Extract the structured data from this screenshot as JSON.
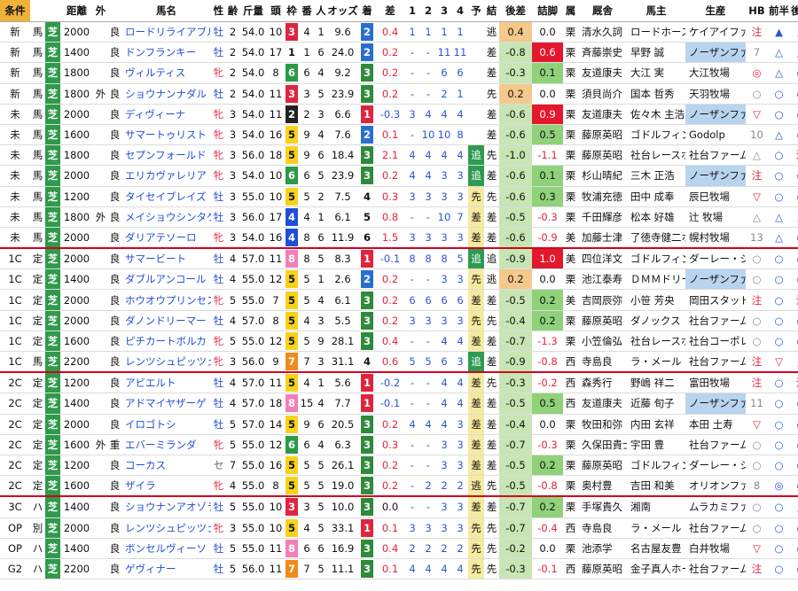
{
  "headers": [
    "条件",
    "",
    "",
    "距離",
    "外",
    "",
    "馬名",
    "性",
    "齢",
    "斤量",
    "頭",
    "枠",
    "番",
    "人",
    "オッズ",
    "着",
    "差",
    "1",
    "2",
    "3",
    "4",
    "予",
    "結",
    "後差",
    "詰脚",
    "属",
    "厩舎",
    "馬主",
    "生産",
    "HB",
    "前半",
    "後半"
  ],
  "waku_colors": {
    "1": "#ffffff",
    "2": "#222222",
    "3": "#e0243e",
    "4": "#1e4fd8",
    "5": "#f7d21a",
    "6": "#2a9a46",
    "7": "#f08a1a",
    "8": "#f27fb8"
  },
  "rank_colors": {
    "1": "#e0243e",
    "2": "#2a6fd0",
    "3": "#2f8a3a"
  },
  "rows": [
    {
      "c": "新",
      "k": "馬",
      "s": "芝",
      "d": "2000",
      "o": "",
      "g": "良",
      "name": "ロードリライアブル",
      "sex": "牡",
      "age": "2",
      "w": "54.0",
      "h": "10",
      "waku": "3",
      "no": "4",
      "pop": "1",
      "odds": "9.6",
      "r": "2",
      "diff": "0.4",
      "p1": "1",
      "p2": "1",
      "p3": "1",
      "p4": "1",
      "yo": "",
      "ke": "逃",
      "b": "0.4",
      "t": "0.0",
      "z": "栗",
      "st": "清水久詞",
      "ow": "ロードホース",
      "pr": "ケイアイファ",
      "hb": "注",
      "f": "▲",
      "l": "▲"
    },
    {
      "c": "新",
      "k": "馬",
      "s": "芝",
      "d": "1400",
      "o": "",
      "g": "良",
      "name": "ドンフランキー",
      "sex": "牡",
      "age": "2",
      "w": "54.0",
      "h": "17",
      "waku": "1",
      "no": "1",
      "pop": "6",
      "odds": "24.0",
      "r": "2",
      "diff": "0.2",
      "p1": "-",
      "p2": "-",
      "p3": "11",
      "p4": "11",
      "yo": "",
      "ke": "差",
      "b": "-0.8",
      "t": "0.6",
      "z": "栗",
      "st": "斉藤崇史",
      "ow": "早野 誠",
      "pr": "ノーザンファ",
      "hb": "7",
      "f": "△",
      "l": "△"
    },
    {
      "c": "新",
      "k": "馬",
      "s": "芝",
      "d": "1800",
      "o": "",
      "g": "良",
      "name": "ヴィルティス",
      "sex": "牝",
      "age": "2",
      "w": "54.0",
      "h": "8",
      "waku": "6",
      "no": "6",
      "pop": "4",
      "odds": "9.2",
      "r": "3",
      "diff": "0.2",
      "p1": "-",
      "p2": "-",
      "p3": "6",
      "p4": "6",
      "yo": "",
      "ke": "差",
      "b": "-0.3",
      "t": "0.1",
      "z": "栗",
      "st": "友道康夫",
      "ow": "大江 実",
      "pr": "大江牧場",
      "hb": "◎",
      "f": "△",
      "l": "○"
    },
    {
      "c": "新",
      "k": "馬",
      "s": "芝",
      "d": "1800",
      "o": "外",
      "g": "良",
      "name": "ショウナンナダル",
      "sex": "牡",
      "age": "2",
      "w": "54.0",
      "h": "11",
      "waku": "3",
      "no": "3",
      "pop": "5",
      "odds": "23.9",
      "r": "3",
      "diff": "0.2",
      "p1": "-",
      "p2": "-",
      "p3": "2",
      "p4": "1",
      "yo": "",
      "ke": "先",
      "b": "0.2",
      "t": "0.0",
      "z": "栗",
      "st": "須貝尚介",
      "ow": "国本 哲秀",
      "pr": "天羽牧場",
      "hb": "○",
      "f": "○",
      "l": "○"
    },
    {
      "c": "未",
      "k": "馬",
      "s": "芝",
      "d": "2000",
      "o": "",
      "g": "良",
      "name": "ディヴィーナ",
      "sex": "牝",
      "age": "3",
      "w": "54.0",
      "h": "11",
      "waku": "2",
      "no": "2",
      "pop": "3",
      "odds": "6.6",
      "r": "1",
      "diff": "-0.3",
      "p1": "3",
      "p2": "4",
      "p3": "4",
      "p4": "4",
      "yo": "",
      "ke": "差",
      "b": "-0.6",
      "t": "0.9",
      "z": "栗",
      "st": "友道康夫",
      "ow": "佐々木 主浩",
      "pr": "ノーザンファ",
      "hb": "▽",
      "f": "○",
      "l": "○"
    },
    {
      "c": "未",
      "k": "馬",
      "s": "芝",
      "d": "1600",
      "o": "",
      "g": "良",
      "name": "サマートゥリスト",
      "sex": "牝",
      "age": "3",
      "w": "54.0",
      "h": "16",
      "waku": "5",
      "no": "9",
      "pop": "4",
      "odds": "7.6",
      "r": "2",
      "diff": "0.1",
      "p1": "-",
      "p2": "10",
      "p3": "10",
      "p4": "8",
      "yo": "",
      "ke": "差",
      "b": "-0.6",
      "t": "0.5",
      "z": "栗",
      "st": "藤原英昭",
      "ow": "ゴドルフィン",
      "pr": "Godolp",
      "hb": "10",
      "f": "△",
      "l": "○"
    },
    {
      "c": "未",
      "k": "馬",
      "s": "芝",
      "d": "1800",
      "o": "",
      "g": "良",
      "name": "セプンフォールド",
      "sex": "牝",
      "age": "3",
      "w": "56.0",
      "h": "18",
      "waku": "5",
      "no": "9",
      "pop": "6",
      "odds": "18.4",
      "r": "3",
      "diff": "2.1",
      "p1": "4",
      "p2": "4",
      "p3": "4",
      "p4": "4",
      "yo": "追",
      "ke": "先",
      "b": "-1.0",
      "t": "-1.1",
      "z": "栗",
      "st": "藤原英昭",
      "ow": "社台レースホ",
      "pr": "社台ファーム",
      "hb": "△",
      "f": "○",
      "l": "注"
    },
    {
      "c": "未",
      "k": "馬",
      "s": "芝",
      "d": "2000",
      "o": "",
      "g": "良",
      "name": "エリカヴァレリア",
      "sex": "牝",
      "age": "3",
      "w": "54.0",
      "h": "10",
      "waku": "6",
      "no": "6",
      "pop": "5",
      "odds": "23.9",
      "r": "3",
      "diff": "0.2",
      "p1": "4",
      "p2": "4",
      "p3": "3",
      "p4": "3",
      "yo": "追",
      "ke": "差",
      "b": "-0.6",
      "t": "0.1",
      "z": "栗",
      "st": "杉山晴紀",
      "ow": "三木 正浩",
      "pr": "ノーザンファ",
      "hb": "注",
      "f": "○",
      "l": "○"
    },
    {
      "c": "未",
      "k": "馬",
      "s": "芝",
      "d": "1200",
      "o": "",
      "g": "良",
      "name": "タイセイブレイズ",
      "sex": "牡",
      "age": "3",
      "w": "55.0",
      "h": "10",
      "waku": "5",
      "no": "5",
      "pop": "2",
      "odds": "7.5",
      "r": "4",
      "diff": "0.3",
      "p1": "3",
      "p2": "3",
      "p3": "3",
      "p4": "3",
      "yo": "先",
      "ke": "先",
      "b": "-0.6",
      "t": "0.3",
      "z": "栗",
      "st": "牧浦充徳",
      "ow": "田中 成奉",
      "pr": "辰巳牧場",
      "hb": "▽",
      "f": "○",
      "l": "○"
    },
    {
      "c": "未",
      "k": "馬",
      "s": "芝",
      "d": "1800",
      "o": "外",
      "g": "良",
      "name": "メイショウシンタケ",
      "sex": "牡",
      "age": "3",
      "w": "56.0",
      "h": "17",
      "waku": "4",
      "no": "4",
      "pop": "1",
      "odds": "6.1",
      "r": "5",
      "diff": "0.8",
      "p1": "-",
      "p2": "-",
      "p3": "10",
      "p4": "7",
      "yo": "差",
      "ke": "差",
      "b": "-0.5",
      "t": "-0.3",
      "z": "栗",
      "st": "千田輝彦",
      "ow": "松本 好雄",
      "pr": "辻 牧場",
      "hb": "△",
      "f": "△",
      "l": "▲"
    },
    {
      "c": "未",
      "k": "馬",
      "s": "芝",
      "d": "2000",
      "o": "",
      "g": "良",
      "name": "ダリアテソーロ",
      "sex": "牝",
      "age": "3",
      "w": "54.0",
      "h": "16",
      "waku": "4",
      "no": "8",
      "pop": "6",
      "odds": "11.9",
      "r": "6",
      "diff": "1.5",
      "p1": "3",
      "p2": "3",
      "p3": "3",
      "p4": "3",
      "yo": "差",
      "ke": "差",
      "b": "-0.6",
      "t": "-0.9",
      "z": "美",
      "st": "加藤士津",
      "ow": "了徳寺健二ホ",
      "pr": "幌村牧場",
      "hb": "13",
      "f": "△",
      "l": "○",
      "sep": true
    },
    {
      "c": "1C",
      "k": "定",
      "s": "芝",
      "d": "2000",
      "o": "",
      "g": "良",
      "name": "サマービート",
      "sex": "牡",
      "age": "4",
      "w": "57.0",
      "h": "11",
      "waku": "8",
      "no": "8",
      "pop": "5",
      "odds": "8.3",
      "r": "1",
      "diff": "-0.1",
      "p1": "8",
      "p2": "8",
      "p3": "8",
      "p4": "5",
      "yo": "追",
      "ke": "追",
      "b": "-0.9",
      "t": "1.0",
      "z": "美",
      "st": "四位洋文",
      "ow": "ゴドルフィン",
      "pr": "ダーレー・ジ",
      "hb": "○",
      "f": "○",
      "l": "◎"
    },
    {
      "c": "1C",
      "k": "定",
      "s": "芝",
      "d": "1400",
      "o": "",
      "g": "良",
      "name": "ダブルアンコール",
      "sex": "牡",
      "age": "4",
      "w": "55.0",
      "h": "12",
      "waku": "5",
      "no": "5",
      "pop": "1",
      "odds": "2.6",
      "r": "2",
      "diff": "0.2",
      "p1": "-",
      "p2": "-",
      "p3": "3",
      "p4": "3",
      "yo": "先",
      "ke": "逃",
      "b": "0.2",
      "t": "0.0",
      "z": "栗",
      "st": "池江泰寿",
      "ow": "ＤＭＭドリー",
      "pr": "ノーザンファ",
      "hb": "○",
      "f": "○",
      "l": "○"
    },
    {
      "c": "1C",
      "k": "定",
      "s": "芝",
      "d": "2000",
      "o": "",
      "g": "良",
      "name": "ホウオウプリンセス",
      "sex": "牝",
      "age": "5",
      "w": "55.0",
      "h": "7",
      "waku": "5",
      "no": "5",
      "pop": "4",
      "odds": "6.1",
      "r": "3",
      "diff": "0.2",
      "p1": "6",
      "p2": "6",
      "p3": "6",
      "p4": "6",
      "yo": "差",
      "ke": "差",
      "b": "-0.5",
      "t": "0.2",
      "z": "美",
      "st": "吉岡辰弥",
      "ow": "小笹 芳央",
      "pr": "岡田スタッド",
      "hb": "注",
      "f": "○",
      "l": "注"
    },
    {
      "c": "1C",
      "k": "定",
      "s": "芝",
      "d": "2000",
      "o": "",
      "g": "良",
      "name": "ダノンドリーマー",
      "sex": "牡",
      "age": "4",
      "w": "57.0",
      "h": "8",
      "waku": "5",
      "no": "4",
      "pop": "3",
      "odds": "5.5",
      "r": "3",
      "diff": "0.2",
      "p1": "3",
      "p2": "3",
      "p3": "3",
      "p4": "3",
      "yo": "先",
      "ke": "先",
      "b": "-0.4",
      "t": "0.2",
      "z": "栗",
      "st": "藤原英昭",
      "ow": "ダノックス",
      "pr": "社台ファーム",
      "hb": "○",
      "f": "○",
      "l": "○"
    },
    {
      "c": "1C",
      "k": "定",
      "s": "芝",
      "d": "1600",
      "o": "",
      "g": "良",
      "name": "ピチカートボルカ",
      "sex": "牝",
      "age": "5",
      "w": "55.0",
      "h": "12",
      "waku": "5",
      "no": "5",
      "pop": "9",
      "odds": "28.1",
      "r": "3",
      "diff": "0.4",
      "p1": "-",
      "p2": "-",
      "p3": "4",
      "p4": "4",
      "yo": "差",
      "ke": "差",
      "b": "-0.7",
      "t": "-1.3",
      "z": "栗",
      "st": "小笠倫弘",
      "ow": "社台レースホ",
      "pr": "社台コーポレ",
      "hb": "○",
      "f": "○",
      "l": "○"
    },
    {
      "c": "1C",
      "k": "馬",
      "s": "芝",
      "d": "2200",
      "o": "",
      "g": "良",
      "name": "レンツシュピッツェ",
      "sex": "牝",
      "age": "3",
      "w": "56.0",
      "h": "9",
      "waku": "7",
      "no": "7",
      "pop": "3",
      "odds": "31.1",
      "r": "4",
      "diff": "0.6",
      "p1": "5",
      "p2": "5",
      "p3": "6",
      "p4": "3",
      "yo": "追",
      "ke": "差",
      "b": "-0.9",
      "t": "-0.8",
      "z": "西",
      "st": "寺島良",
      "ow": "ラ・メール",
      "pr": "社台ファーム",
      "hb": "注",
      "f": "▽",
      "l": "▲",
      "sep": true
    },
    {
      "c": "2C",
      "k": "定",
      "s": "芝",
      "d": "1200",
      "o": "",
      "g": "良",
      "name": "アビエルト",
      "sex": "牡",
      "age": "4",
      "w": "57.0",
      "h": "11",
      "waku": "5",
      "no": "4",
      "pop": "1",
      "odds": "5.6",
      "r": "1",
      "diff": "-0.2",
      "p1": "-",
      "p2": "-",
      "p3": "4",
      "p4": "4",
      "yo": "差",
      "ke": "先",
      "b": "-0.3",
      "t": "-0.2",
      "z": "西",
      "st": "森秀行",
      "ow": "野嶋 祥二",
      "pr": "富田牧場",
      "hb": "注",
      "f": "○",
      "l": "注"
    },
    {
      "c": "2C",
      "k": "定",
      "s": "芝",
      "d": "1400",
      "o": "",
      "g": "良",
      "name": "アドマイヤザーゲ",
      "sex": "牡",
      "age": "4",
      "w": "57.0",
      "h": "18",
      "waku": "8",
      "no": "15",
      "pop": "4",
      "odds": "7.7",
      "r": "1",
      "diff": "-0.1",
      "p1": "-",
      "p2": "-",
      "p3": "4",
      "p4": "4",
      "yo": "差",
      "ke": "差",
      "b": "-0.5",
      "t": "0.5",
      "z": "西",
      "st": "友道康夫",
      "ow": "近藤 旬子",
      "pr": "ノーザンファ",
      "hb": "11",
      "f": "○",
      "l": "○"
    },
    {
      "c": "2C",
      "k": "定",
      "s": "芝",
      "d": "2000",
      "o": "",
      "g": "良",
      "name": "イロゴトシ",
      "sex": "牡",
      "age": "5",
      "w": "57.0",
      "h": "14",
      "waku": "5",
      "no": "9",
      "pop": "6",
      "odds": "20.5",
      "r": "3",
      "diff": "0.2",
      "p1": "4",
      "p2": "4",
      "p3": "4",
      "p4": "3",
      "yo": "差",
      "ke": "差",
      "b": "-0.4",
      "t": "0.0",
      "z": "栗",
      "st": "牧田和弥",
      "ow": "内田 玄祥",
      "pr": "本田 土寿",
      "hb": "▽",
      "f": "○",
      "l": "○"
    },
    {
      "c": "2C",
      "k": "定",
      "s": "芝",
      "d": "1600",
      "o": "外",
      "g": "重",
      "name": "エバーミランダ",
      "sex": "牝",
      "age": "5",
      "w": "55.0",
      "h": "12",
      "waku": "6",
      "no": "6",
      "pop": "4",
      "odds": "6.3",
      "r": "3",
      "diff": "0.3",
      "p1": "-",
      "p2": "-",
      "p3": "3",
      "p4": "3",
      "yo": "差",
      "ke": "差",
      "b": "-0.7",
      "t": "-0.3",
      "z": "栗",
      "st": "久保田貴士",
      "ow": "宇田 豊",
      "pr": "社台ファーム",
      "hb": "○",
      "f": "○",
      "l": "○"
    },
    {
      "c": "2C",
      "k": "定",
      "s": "芝",
      "d": "1200",
      "o": "",
      "g": "良",
      "name": "コーカス",
      "sex": "セ",
      "age": "7",
      "w": "55.0",
      "h": "16",
      "waku": "5",
      "no": "5",
      "pop": "5",
      "odds": "26.1",
      "r": "3",
      "diff": "0.2",
      "p1": "-",
      "p2": "-",
      "p3": "3",
      "p4": "3",
      "yo": "差",
      "ke": "差",
      "b": "-0.5",
      "t": "0.2",
      "z": "栗",
      "st": "藤原英昭",
      "ow": "ゴドルフィン",
      "pr": "ダーレー・ジ",
      "hb": "○",
      "f": "○",
      "l": "○"
    },
    {
      "c": "2C",
      "k": "定",
      "s": "芝",
      "d": "1600",
      "o": "",
      "g": "良",
      "name": "ザイラ",
      "sex": "牝",
      "age": "4",
      "w": "55.0",
      "h": "8",
      "waku": "5",
      "no": "5",
      "pop": "5",
      "odds": "19.0",
      "r": "3",
      "diff": "0.2",
      "p1": "-",
      "p2": "2",
      "p3": "2",
      "p4": "2",
      "yo": "逃",
      "ke": "先",
      "b": "-0.5",
      "t": "-0.8",
      "z": "栗",
      "st": "奥村豊",
      "ow": "吉田 和美",
      "pr": "オリオンファ",
      "hb": "8",
      "f": "◎",
      "l": "○",
      "sep": true
    },
    {
      "c": "3C",
      "k": "ハ",
      "s": "芝",
      "d": "1400",
      "o": "",
      "g": "良",
      "name": "ショウナンアオゾラ",
      "sex": "牡",
      "age": "5",
      "w": "55.0",
      "h": "10",
      "waku": "3",
      "no": "3",
      "pop": "5",
      "odds": "10.0",
      "r": "3",
      "diff": "0.0",
      "p1": "-",
      "p2": "-",
      "p3": "3",
      "p4": "3",
      "yo": "差",
      "ke": "差",
      "b": "-0.7",
      "t": "0.2",
      "z": "栗",
      "st": "手塚貴久",
      "ow": "湘南",
      "pr": "ムラカミファ",
      "hb": "○",
      "f": "○",
      "l": "▲"
    },
    {
      "c": "OP",
      "k": "別",
      "s": "芝",
      "d": "2000",
      "o": "",
      "g": "良",
      "name": "レンツシュピッツェ",
      "sex": "牝",
      "age": "3",
      "w": "55.0",
      "h": "10",
      "waku": "5",
      "no": "4",
      "pop": "5",
      "odds": "33.1",
      "r": "1",
      "diff": "0.1",
      "p1": "3",
      "p2": "3",
      "p3": "3",
      "p4": "3",
      "yo": "先",
      "ke": "先",
      "b": "-0.7",
      "t": "-0.4",
      "z": "西",
      "st": "寺島良",
      "ow": "ラ・メール",
      "pr": "社台ファーム",
      "hb": "○",
      "f": "○",
      "l": "○"
    },
    {
      "c": "OP",
      "k": "ハ",
      "s": "芝",
      "d": "1400",
      "o": "",
      "g": "良",
      "name": "ボンセルヴィーソ",
      "sex": "牡",
      "age": "5",
      "w": "55.0",
      "h": "11",
      "waku": "8",
      "no": "6",
      "pop": "6",
      "odds": "16.9",
      "r": "3",
      "diff": "0.4",
      "p1": "2",
      "p2": "2",
      "p3": "2",
      "p4": "2",
      "yo": "先",
      "ke": "先",
      "b": "-0.2",
      "t": "0.0",
      "z": "栗",
      "st": "池添学",
      "ow": "名古屋友豊",
      "pr": "白井牧場",
      "hb": "▽",
      "f": "○",
      "l": "○"
    },
    {
      "c": "G2",
      "k": "ハ",
      "s": "芝",
      "d": "2200",
      "o": "",
      "g": "良",
      "name": "ゲヴィナー",
      "sex": "牡",
      "age": "5",
      "w": "56.0",
      "h": "11",
      "waku": "7",
      "no": "7",
      "pop": "5",
      "odds": "11.1",
      "r": "3",
      "diff": "0.1",
      "p1": "4",
      "p2": "4",
      "p3": "4",
      "p4": "4",
      "yo": "先",
      "ke": "先",
      "b": "-0.3",
      "t": "-0.1",
      "z": "西",
      "st": "藤原英昭",
      "ow": "金子真人ホー",
      "pr": "社台ファーム",
      "hb": "注",
      "f": "○",
      "l": "○"
    }
  ]
}
